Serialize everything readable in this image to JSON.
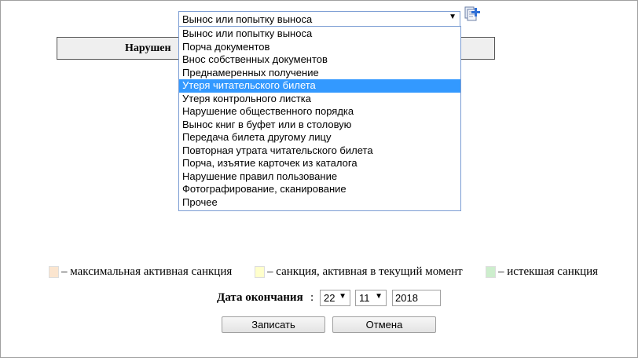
{
  "violation_header": {
    "label": "Нарушен"
  },
  "violation_select": {
    "value": "Вынос или попытку выноса",
    "arrow": "▼",
    "options": [
      "Вынос или попытку выноса",
      "Порча документов",
      "Внос собственных документов",
      "Преднамеренных получение",
      "Утеря читательского билета",
      "Утеря контрольного листка",
      "Нарушение общественного порядка",
      "Вынос книг в буфет или в столовую",
      "Передача билета другому лицу",
      "Повторная утрата читательского билета",
      "Порча, изъятие карточек из каталога",
      "Нарушение правил пользование",
      "Фотографирование, сканирование",
      "Прочее"
    ],
    "highlighted_index": 4,
    "add_icon": "add-document-icon"
  },
  "legend": {
    "max_active": "– максимальная активная санкция",
    "current_active": "– санкция, активная в текущий момент",
    "expired": "– истекшая санкция",
    "colors": {
      "max_active": "#fbe5cf",
      "current_active": "#ffffcc",
      "expired": "#cdeecd"
    }
  },
  "end_date": {
    "label": "Дата окончания",
    "colon": ":",
    "day": "22",
    "month": "11",
    "year": "2018",
    "arrow": "▼"
  },
  "buttons": {
    "save": "Записать",
    "cancel": "Отмена"
  }
}
